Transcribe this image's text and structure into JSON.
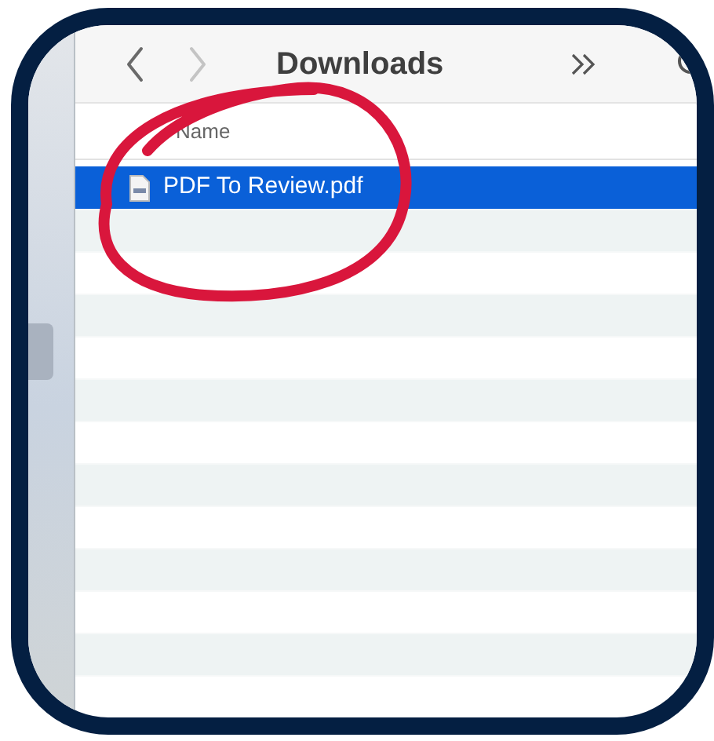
{
  "toolbar": {
    "back_disabled": false,
    "forward_disabled": true,
    "title": "Downloads"
  },
  "table": {
    "columns": [
      {
        "label": "Name"
      }
    ],
    "rows": [
      {
        "name": "PDF To Review.pdf",
        "selected": true
      }
    ]
  }
}
